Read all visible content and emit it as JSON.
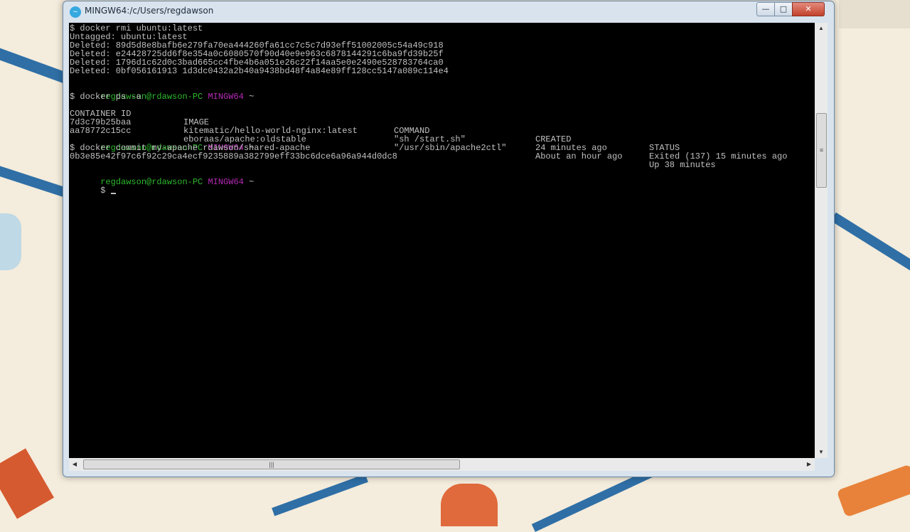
{
  "window": {
    "title": "MINGW64:/c/Users/regdawson",
    "app_icon_glyph": "~",
    "buttons": {
      "minimize": "—",
      "maximize": "□",
      "close": "✕"
    }
  },
  "terminal": {
    "rmi_block": [
      "$ docker rmi ubuntu:latest",
      "Untagged: ubuntu:latest",
      "Deleted: 89d5d8e8bafb6e279fa70ea444260fa61cc7c5c7d93eff51002005c54a49c918",
      "Deleted: e24428725dd6f8e354a0c6080570f90d40e9e963c6878144291c6ba9fd39b25f",
      "Deleted: 1796d1c62d0c3bad665cc4fbe4b6a051e26c22f14aa5e0e2490e528783764ca0",
      "Deleted: 0bf056161913 1d3dc0432a2b40a9438bd48f4a84e89ff128cc5147a089c114e4"
    ],
    "prompt": {
      "user": "regdawson@rdawson-PC",
      "env": "MINGW64",
      "dir": "~",
      "symbol": "$"
    },
    "ps_command": "$ docker ps -a",
    "ps_table": {
      "headers": [
        "CONTAINER ID",
        "IMAGE",
        "COMMAND",
        "CREATED",
        "STATUS"
      ],
      "rows": [
        [
          "7d3c79b25baa",
          "kitematic/hello-world-nginx:latest",
          "\"sh /start.sh\"",
          "24 minutes ago",
          "Exited (137) 15 minutes ago"
        ],
        [
          "aa78772c15cc",
          "eboraas/apache:oldstable",
          "\"/usr/sbin/apache2ctl\"",
          "About an hour ago",
          "Up 38 minutes"
        ]
      ]
    },
    "commit_command": "$ docker commit my-apache rdawson/shared-apache",
    "commit_output": "0b3e85e42f97c6f92c29ca4ecf9235889a382799eff33bc6dce6a96a944d0dc8"
  },
  "scrollbars": {
    "up": "▲",
    "down": "▼",
    "left": "◀",
    "right": "▶",
    "grip_v": "≡",
    "grip_h": "|||"
  }
}
